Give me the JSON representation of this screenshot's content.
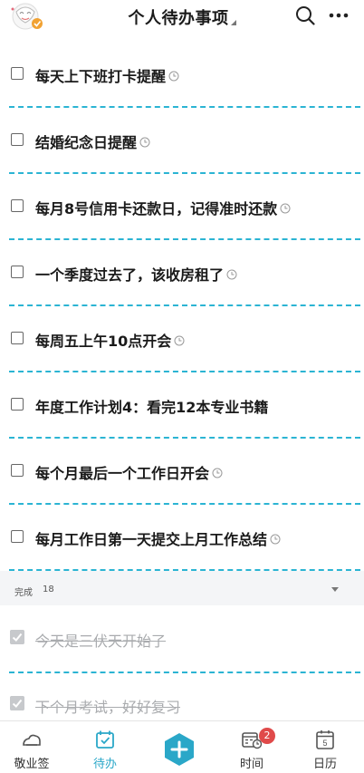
{
  "header": {
    "title": "个人待办事项"
  },
  "todos": [
    {
      "text": "每天上下班打卡提醒",
      "has_reminder": true
    },
    {
      "text": "结婚纪念日提醒",
      "has_reminder": true
    },
    {
      "text": "每月8号信用卡还款日，记得准时还款",
      "has_reminder": true
    },
    {
      "text": "一个季度过去了，该收房租了",
      "has_reminder": true
    },
    {
      "text": "每周五上午10点开会",
      "has_reminder": true
    },
    {
      "text": "年度工作计划4：看完12本专业书籍",
      "has_reminder": false
    },
    {
      "text": "每个月最后一个工作日开会",
      "has_reminder": true
    },
    {
      "text": "每月工作日第一天提交上月工作总结",
      "has_reminder": true
    }
  ],
  "completed": {
    "label": "完成",
    "count": "18",
    "items": [
      {
        "text": "今天是三伏天开始了"
      },
      {
        "text": "下个月考试，好好复习"
      }
    ]
  },
  "tabbar": {
    "tabs": [
      {
        "label": "敬业签",
        "icon": "cloud-note-icon"
      },
      {
        "label": "待办",
        "icon": "calendar-check-icon",
        "active": true
      },
      {
        "label": "时间",
        "icon": "calendar-clock-icon",
        "badge": "2"
      },
      {
        "label": "日历",
        "icon": "calendar-day-icon",
        "day": "5"
      }
    ],
    "add_icon": "plus-hexagon-icon"
  },
  "colors": {
    "accent": "#2aa7c8",
    "divider": "#2bb4d3",
    "badge": "#e04a4a",
    "done_text": "#a9abae"
  }
}
